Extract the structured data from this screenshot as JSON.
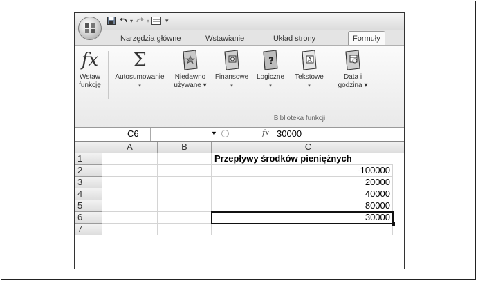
{
  "quick_access": {
    "save_icon": "save-icon",
    "undo_icon": "undo-icon",
    "redo_icon": "redo-icon",
    "more": "▾"
  },
  "tabs": [
    {
      "label": "Narzędzia główne",
      "active": false
    },
    {
      "label": "Wstawianie",
      "active": false
    },
    {
      "label": "Układ strony",
      "active": false
    },
    {
      "label": "Formuły",
      "active": true
    }
  ],
  "ribbon": {
    "insert_function": {
      "icon": "fx",
      "label1": "Wstaw",
      "label2": "funkcję"
    },
    "autosum": {
      "icon": "Σ",
      "label1": "Autosumowanie",
      "label2": "▾"
    },
    "recent": {
      "label1": "Niedawno",
      "label2": "używane ▾"
    },
    "financial": {
      "label1": "Finansowe",
      "label2": "▾"
    },
    "logical": {
      "label1": "Logiczne",
      "label2": "▾"
    },
    "text": {
      "label1": "Tekstowe",
      "label2": "▾"
    },
    "datetime": {
      "label1": "Data i",
      "label2": "godzina ▾"
    },
    "group_label": "Biblioteka funkcji"
  },
  "formula_bar": {
    "name_box": "C6",
    "fx": "fx",
    "value": "30000"
  },
  "sheet": {
    "columns": [
      "A",
      "B",
      "C"
    ],
    "rows": [
      "1",
      "2",
      "3",
      "4",
      "5",
      "6",
      "7"
    ],
    "c_values": [
      "Przepływy środków pieniężnych",
      "-100000",
      "20000",
      "40000",
      "80000",
      "30000",
      ""
    ],
    "selected_cell": "C6"
  }
}
